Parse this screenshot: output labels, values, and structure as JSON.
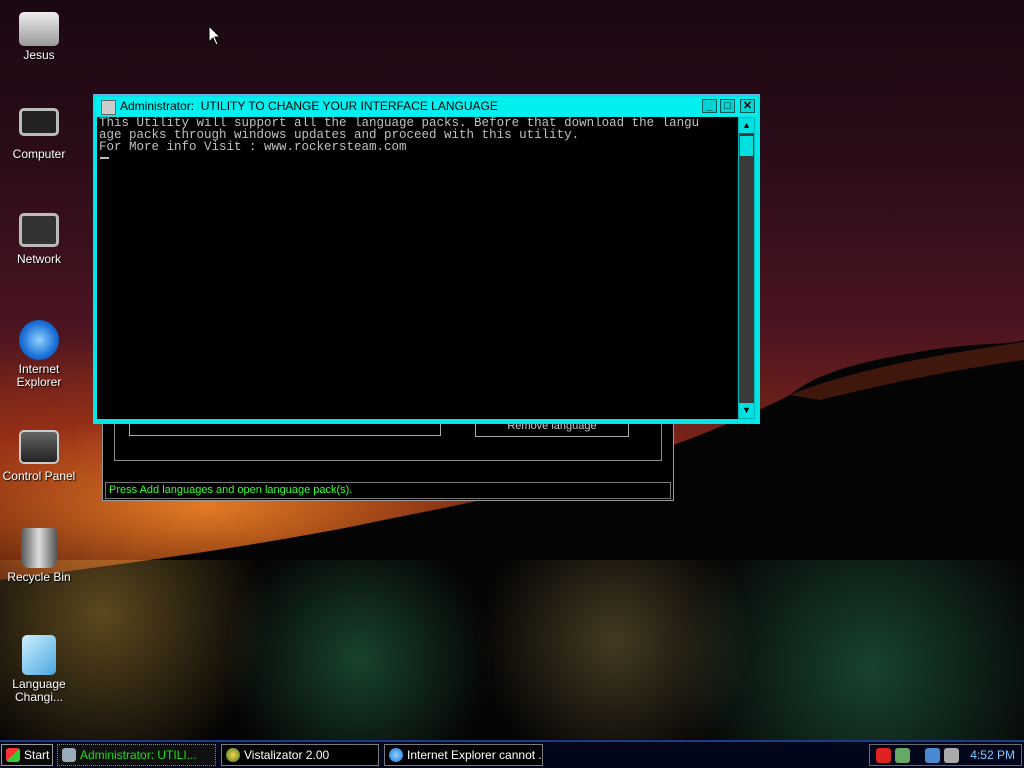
{
  "desktop": {
    "icons": [
      {
        "label": "Jesus",
        "icon": "printer-icon"
      },
      {
        "label": "Computer",
        "icon": "monitor-icon"
      },
      {
        "label": "Network",
        "icon": "network-icon"
      },
      {
        "label": "Internet Explorer",
        "icon": "internet-explorer-icon"
      },
      {
        "label": "Control Panel",
        "icon": "control-panel-icon"
      },
      {
        "label": "Recycle Bin",
        "icon": "recycle-bin-icon"
      },
      {
        "label": "Language Changi...",
        "icon": "language-changer-icon"
      }
    ]
  },
  "background_dialog": {
    "remove_button": "Remove language",
    "status_text": "Press Add languages and open language pack(s)."
  },
  "console": {
    "title": "Administrator:  UTILITY TO CHANGE YOUR INTERFACE LANGUAGE",
    "lines": [
      "This Utility will support all the language packs. Before that download the langu",
      "age packs through windows updates and proceed with this utility.",
      "For More info Visit : www.rockersteam.com"
    ],
    "controls": {
      "minimize": "_",
      "maximize": "□",
      "close": "✕"
    }
  },
  "taskbar": {
    "start_label": "Start",
    "items": [
      {
        "label": "Administrator: UTILI...",
        "active": true
      },
      {
        "label": "Vistalizator 2.00",
        "active": false
      },
      {
        "label": "Internet Explorer cannot ...",
        "active": false
      }
    ],
    "clock": "4:52 PM"
  },
  "colors": {
    "console_frame": "#00e5e5",
    "status_text": "#33ff33",
    "active_task_text": "#16e016",
    "clock": "#7acbff"
  }
}
